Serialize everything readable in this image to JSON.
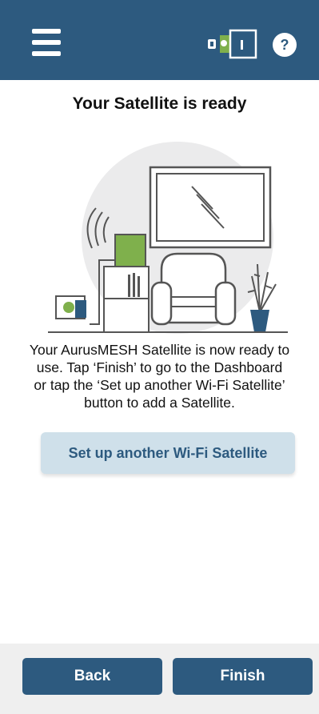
{
  "header": {
    "menu_icon": "hamburger-menu-icon",
    "device_icon": "satellite-status-icon",
    "help_label": "?"
  },
  "page": {
    "title": "Your Satellite is ready",
    "description_lines": [
      "Your AurusMESH Satellite is now ready to",
      "use. Tap ‘Finish’ to go to the Dashboard",
      "or tap the ‘Set up another Wi-Fi Satellite’",
      "button to add a Satellite."
    ]
  },
  "actions": {
    "setup_another_label": "Set up another Wi-Fi Satellite",
    "back_label": "Back",
    "finish_label": "Finish"
  },
  "colors": {
    "brand": "#2d5a7f",
    "light_button": "#cfe0ea",
    "satellite_green": "#7fb04c",
    "footer_bg": "#efefef"
  }
}
